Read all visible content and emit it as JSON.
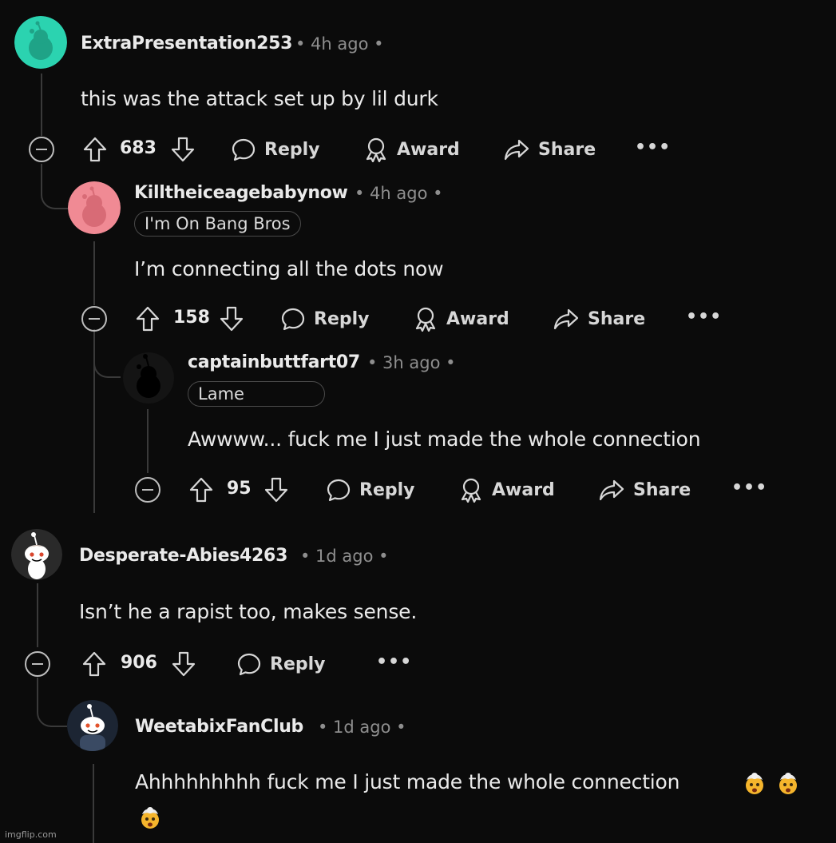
{
  "thread": {
    "c1": {
      "username": "ExtraPresentation253",
      "meta": "• 4h ago •",
      "body": "this was the attack set up by lil durk",
      "score": "683",
      "reply": "Reply",
      "award": "Award",
      "share": "Share",
      "more": "•••",
      "avatar_color": "#2bd3b0"
    },
    "c2": {
      "username": "Killtheiceagebabynow",
      "meta": "• 4h ago •",
      "flair": "I'm On Bang Bros",
      "body": "I’m connecting all the dots now",
      "score": "158",
      "reply": "Reply",
      "award": "Award",
      "share": "Share",
      "more": "•••",
      "avatar_color": "#f08a94"
    },
    "c3": {
      "username": "captainbuttfart07",
      "meta": "• 3h ago •",
      "flair": "Lame",
      "body": "Awwww... fuck me I just made the whole connection",
      "score": "95",
      "reply": "Reply",
      "award": "Award",
      "share": "Share",
      "more": "•••",
      "avatar_color": "#0d0d0d"
    },
    "c4": {
      "username": "Desperate-Abies4263",
      "meta": "• 1d ago •",
      "body": "Isn’t he a rapist too, makes sense.",
      "score": "906",
      "reply": "Reply",
      "more": "•••",
      "avatar_color": "#2a2a2a"
    },
    "c5": {
      "username": "WeetabixFanClub",
      "meta": "• 1d ago •",
      "body": "Ahhhhhhhhh fuck me I just made the whole connection",
      "emoji_name": "exploding-head-emoji",
      "emoji_count": 3,
      "avatar_color": "#1c2533"
    }
  },
  "watermark": "imgflip.com"
}
